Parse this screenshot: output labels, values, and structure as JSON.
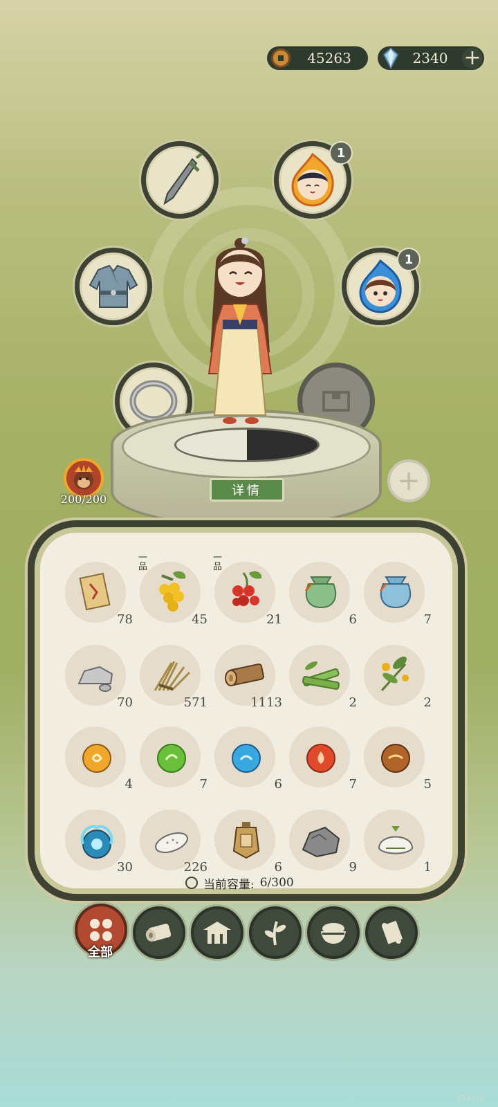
{
  "currency": {
    "coins": "45263",
    "gems": "2340",
    "add_symbol": "+"
  },
  "equipment": {
    "companion_badge_1": "1",
    "companion_badge_2": "1",
    "empty_slot_add": "+"
  },
  "stamina": {
    "value": "200/200"
  },
  "details_button": "详情",
  "inventory": {
    "items": [
      {
        "icon": "scroll-map-icon",
        "count": "78",
        "grade": ""
      },
      {
        "icon": "yellow-berries-icon",
        "count": "45",
        "grade": "一品"
      },
      {
        "icon": "red-berries-icon",
        "count": "21",
        "grade": "一品"
      },
      {
        "icon": "green-pouch-icon",
        "count": "6",
        "grade": ""
      },
      {
        "icon": "blue-pouch-icon",
        "count": "7",
        "grade": ""
      },
      {
        "icon": "stone-icon",
        "count": "70",
        "grade": ""
      },
      {
        "icon": "straw-bundle-icon",
        "count": "571",
        "grade": ""
      },
      {
        "icon": "log-icon",
        "count": "1113",
        "grade": ""
      },
      {
        "icon": "bamboo-icon",
        "count": "2",
        "grade": ""
      },
      {
        "icon": "herb-flower-icon",
        "count": "2",
        "grade": ""
      },
      {
        "icon": "gold-orb-icon",
        "count": "4",
        "grade": ""
      },
      {
        "icon": "green-orb-icon",
        "count": "7",
        "grade": ""
      },
      {
        "icon": "blue-orb-icon",
        "count": "6",
        "grade": ""
      },
      {
        "icon": "red-orb-icon",
        "count": "7",
        "grade": ""
      },
      {
        "icon": "brown-orb-icon",
        "count": "5",
        "grade": ""
      },
      {
        "icon": "blue-flame-orb-icon",
        "count": "30",
        "grade": ""
      },
      {
        "icon": "white-seed-icon",
        "count": "226",
        "grade": ""
      },
      {
        "icon": "token-plaque-icon",
        "count": "6",
        "grade": ""
      },
      {
        "icon": "ore-rock-icon",
        "count": "9",
        "grade": ""
      },
      {
        "icon": "rice-dumpling-icon",
        "count": "1",
        "grade": ""
      }
    ],
    "capacity_label": "当前容量:",
    "capacity_value": "6/300"
  },
  "tabs": {
    "active_label": "全部",
    "items": [
      "all-icon",
      "wood-icon",
      "building-icon",
      "plant-icon",
      "food-bowl-icon",
      "scroll-icon"
    ]
  },
  "watermark": "534834",
  "colors": {
    "panel_bg": "#f1ede0",
    "ink_border": "#3e4233",
    "active_tab": "#b24a32",
    "details_button": "#5a8a4a"
  }
}
